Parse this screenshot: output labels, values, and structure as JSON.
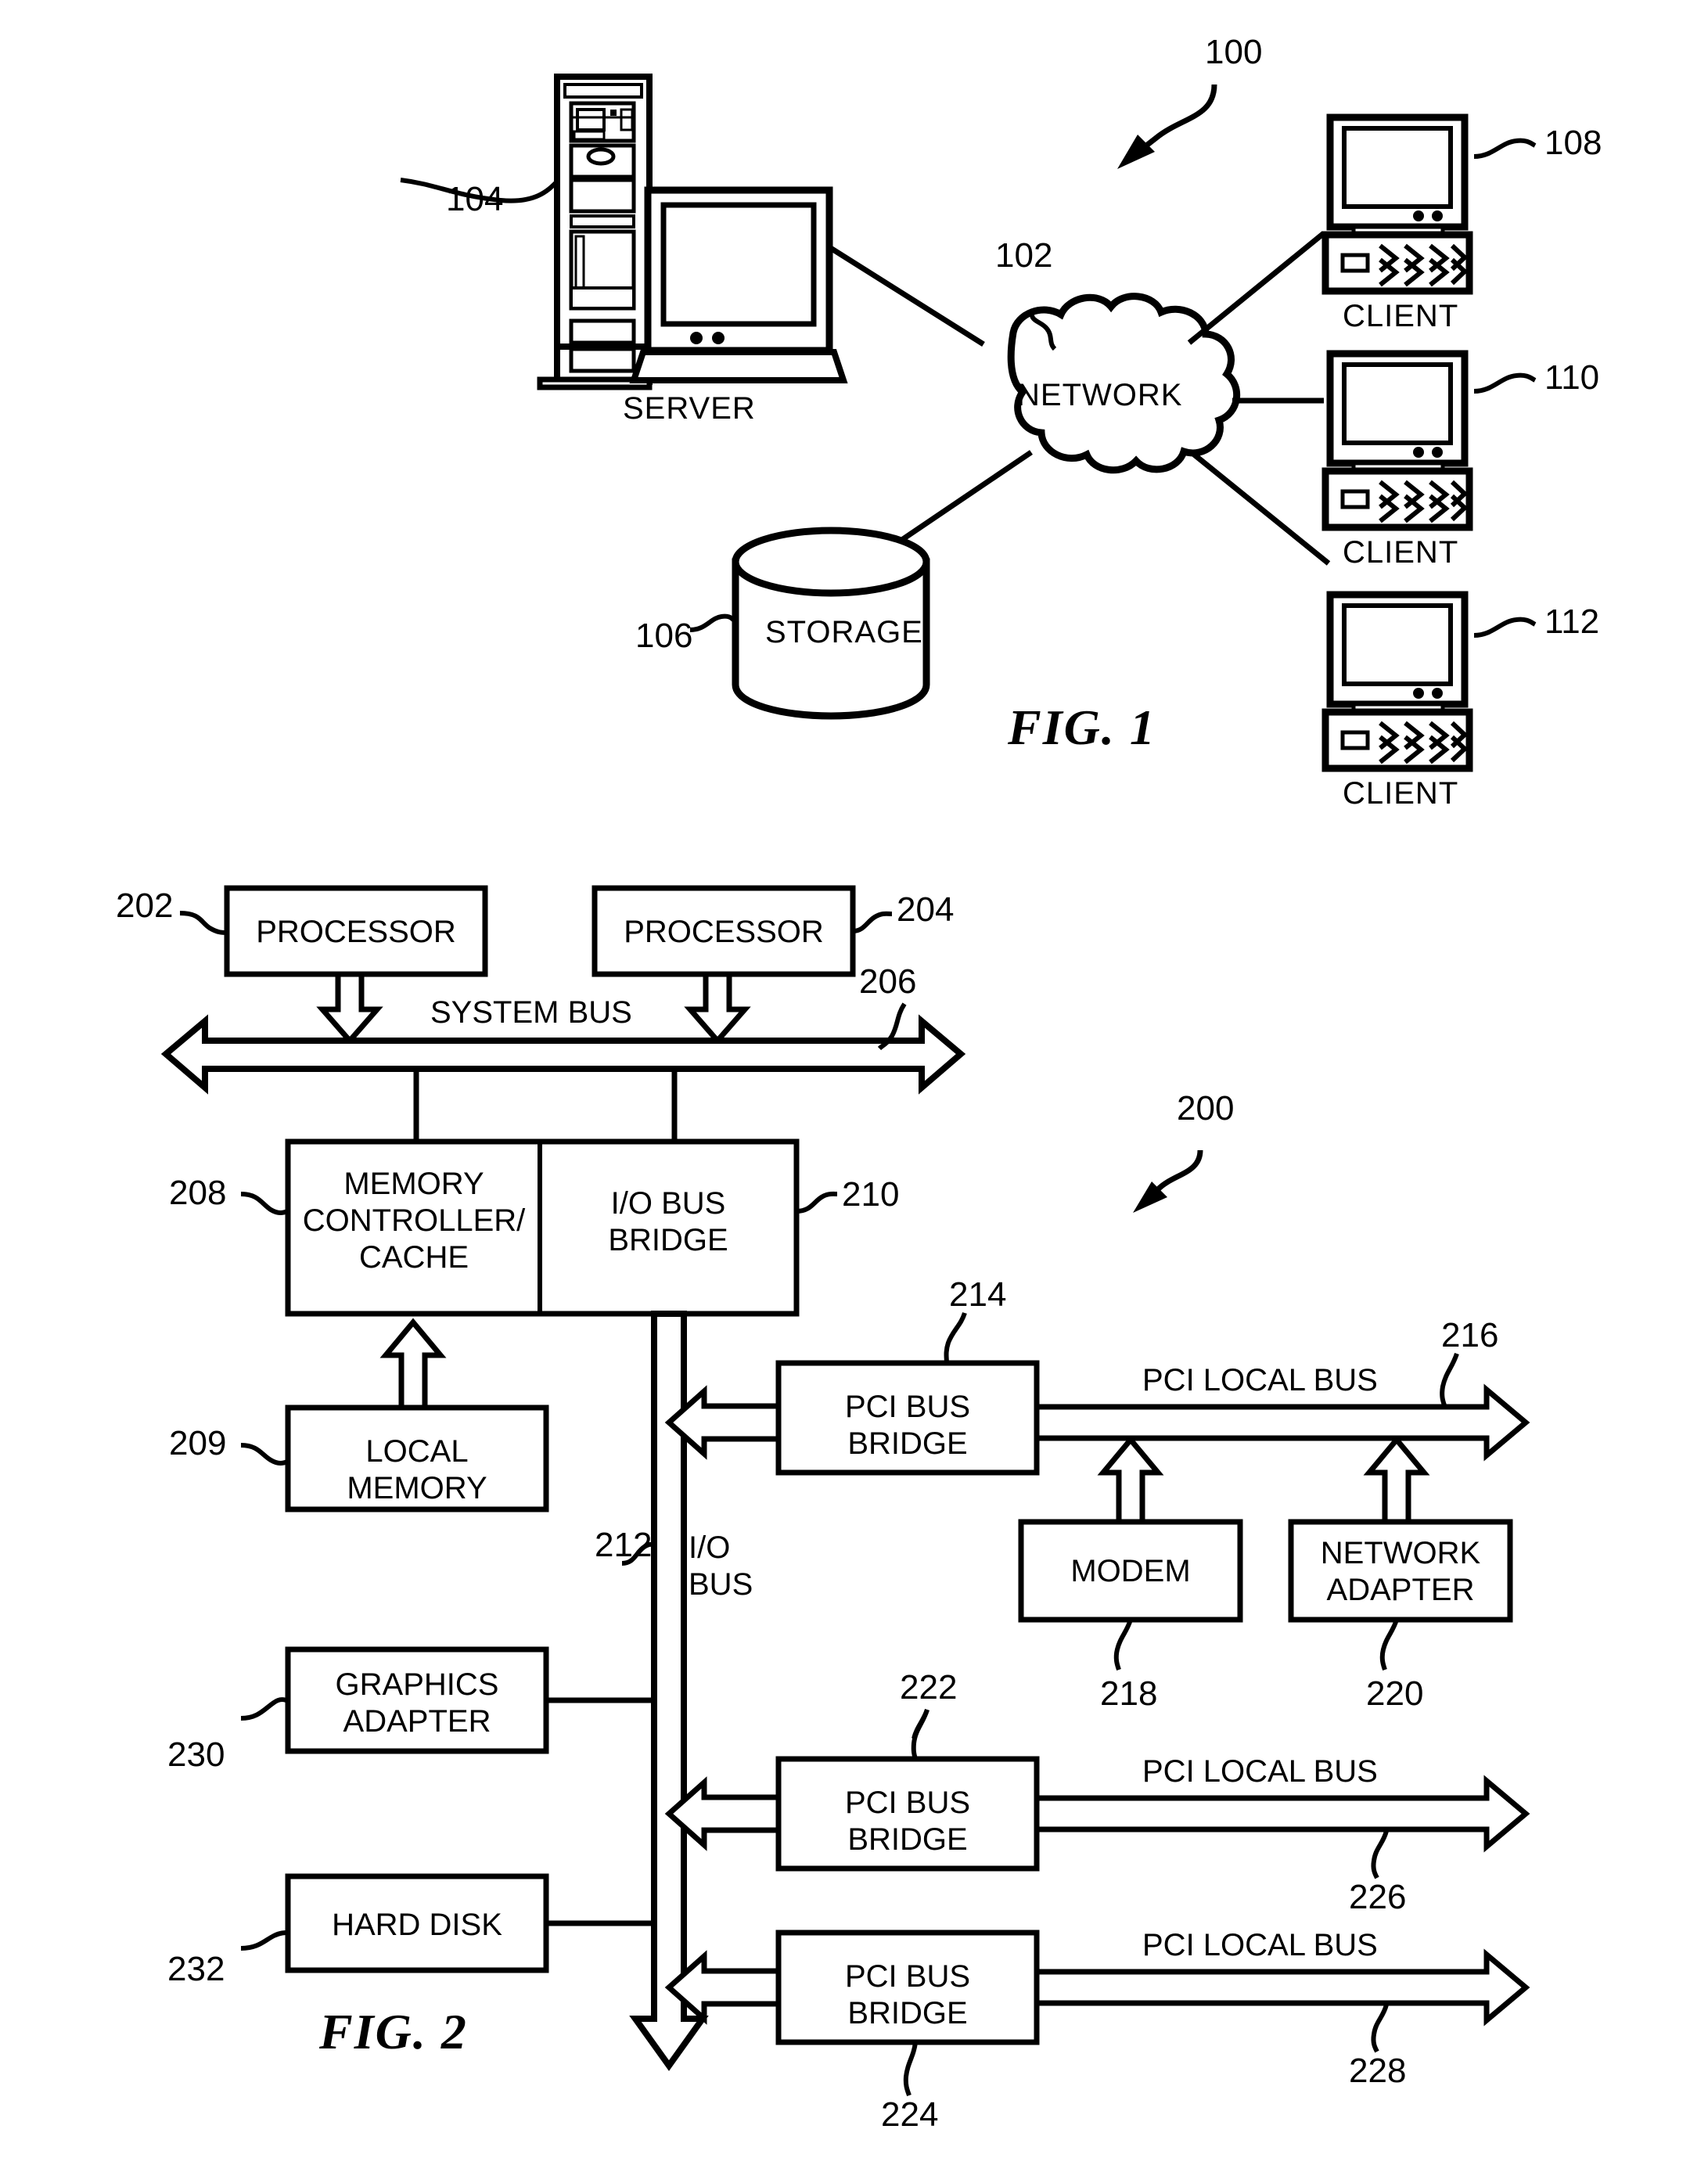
{
  "figures": [
    {
      "id": "fig1",
      "label": "FIG. 1",
      "system_ref": "100",
      "nodes": {
        "server": {
          "caption": "SERVER",
          "ref": "104"
        },
        "network": {
          "caption": "NETWORK",
          "ref": "102"
        },
        "storage": {
          "caption": "STORAGE",
          "ref": "106"
        },
        "client1": {
          "caption": "CLIENT",
          "ref": "108"
        },
        "client2": {
          "caption": "CLIENT",
          "ref": "110"
        },
        "client3": {
          "caption": "CLIENT",
          "ref": "112"
        }
      }
    },
    {
      "id": "fig2",
      "label": "FIG. 2",
      "system_ref": "200",
      "boxes": {
        "processor_left": {
          "label": "PROCESSOR",
          "ref": "202"
        },
        "processor_right": {
          "label": "PROCESSOR",
          "ref": "204"
        },
        "memory_controller": {
          "label": "MEMORY\nCONTROLLER/\nCACHE",
          "ref": "208"
        },
        "io_bus_bridge": {
          "label": "I/O BUS\nBRIDGE",
          "ref": "210"
        },
        "local_memory": {
          "label": "LOCAL\nMEMORY",
          "ref": "209"
        },
        "pci_bus_bridge_1": {
          "label": "PCI BUS\nBRIDGE",
          "ref": "214"
        },
        "pci_bus_bridge_2": {
          "label": "PCI BUS\nBRIDGE",
          "ref": "222"
        },
        "pci_bus_bridge_3": {
          "label": "PCI BUS\nBRIDGE",
          "ref": "224"
        },
        "modem": {
          "label": "MODEM",
          "ref": "218"
        },
        "network_adapter": {
          "label": "NETWORK\nADAPTER",
          "ref": "220"
        },
        "graphics_adapter": {
          "label": "GRAPHICS\nADAPTER",
          "ref": "230"
        },
        "hard_disk": {
          "label": "HARD DISK",
          "ref": "232"
        }
      },
      "buses": {
        "system_bus": {
          "label": "SYSTEM BUS",
          "ref": "206"
        },
        "io_bus": {
          "label": "I/O\nBUS",
          "ref": "212"
        },
        "pci_local_bus_1": {
          "label": "PCI LOCAL BUS",
          "ref": "216"
        },
        "pci_local_bus_2": {
          "label": "PCI LOCAL BUS",
          "ref": "226"
        },
        "pci_local_bus_3": {
          "label": "PCI LOCAL BUS",
          "ref": "228"
        }
      }
    }
  ]
}
